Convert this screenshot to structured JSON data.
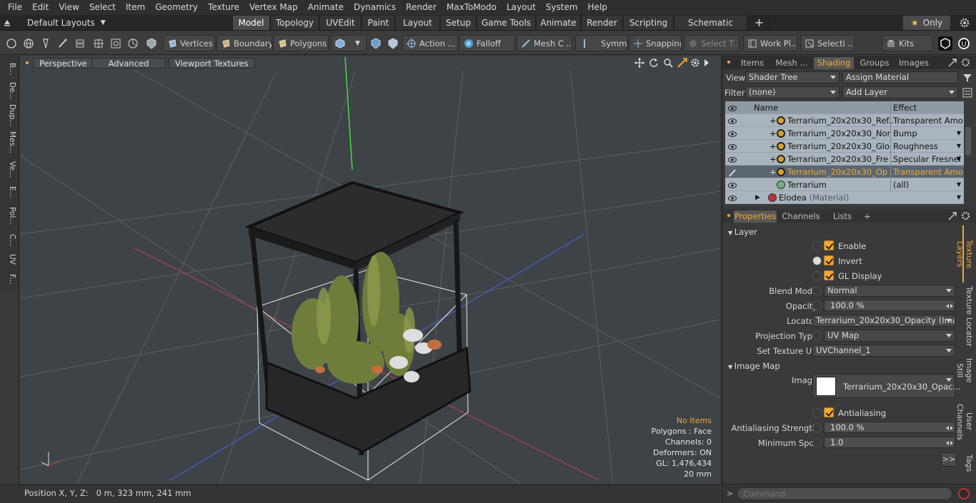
{
  "menu": [
    "File",
    "Edit",
    "View",
    "Select",
    "Item",
    "Geometry",
    "Texture",
    "Vertex Map",
    "Animate",
    "Dynamics",
    "Render",
    "MaxToModo",
    "Layout",
    "System",
    "Help"
  ],
  "modebar": {
    "layouts": "Default Layouts",
    "tabs": [
      "Model",
      "Topology",
      "UVEdit",
      "Paint",
      "Layout",
      "Setup",
      "Game Tools",
      "Animate",
      "Render",
      "Scripting",
      "Schematic Fusion"
    ],
    "active_tab": "Model",
    "only": "Only"
  },
  "toolbar": {
    "vertices": "Vertices",
    "boundary": "Boundary",
    "polygons": "Polygons",
    "action": "Action ...",
    "falloff": "Falloff",
    "mesh": "Mesh C ...",
    "symm": "Symm ...",
    "snapping": "Snapping",
    "select_t": "Select T...",
    "workpl": "Work Pl...",
    "selecti": "Selecti ...",
    "kits": "Kits"
  },
  "lefttabs": [
    "B...",
    "De...",
    "Dup...",
    "Mes...",
    "Ve...",
    "E...",
    "Pol...",
    "C...",
    "UV",
    "F..."
  ],
  "viewport": {
    "perspective": "Perspective",
    "advanced": "Advanced",
    "textures": "Viewport Textures"
  },
  "stats": {
    "noitems": "No Items",
    "polygons": "Polygons : Face",
    "channels": "Channels: 0",
    "deformers": "Deformers: ON",
    "gl": "GL: 1,476,434",
    "scale": "20 mm"
  },
  "status": "Position X, Y, Z:   0 m, 323 mm, 241 mm",
  "top_tabs": [
    "Items",
    "Mesh ...",
    "Shading",
    "Groups",
    "Images"
  ],
  "shading": {
    "view_label": "View",
    "view_value": "Shader Tree",
    "assign": "Assign Material",
    "filter_label": "Filter",
    "filter_value": "(none)",
    "add_layer": "Add Layer",
    "col_name": "Name",
    "col_effect": "Effect",
    "rows": [
      {
        "name": "Terrarium_20x20x30_Ref...",
        "effect": "Transparent Amo ..."
      },
      {
        "name": "Terrarium_20x20x30_Nor ...",
        "effect": "Bump"
      },
      {
        "name": "Terrarium_20x20x30_Glo ...",
        "effect": "Roughness"
      },
      {
        "name": "Terrarium_20x20x30_Fre ...",
        "effect": "Specular Fresnel"
      },
      {
        "name": "Terrarium_20x20x30_Op ...",
        "effect": "Transparent Amo ..."
      },
      {
        "name": "Terrarium",
        "effect": "(all)"
      },
      {
        "name": "Elodea",
        "sub": "(Material)",
        "effect": ""
      }
    ]
  },
  "prop_tabs": [
    "Properties",
    "Channels",
    "Lists"
  ],
  "props": {
    "layer": "Layer",
    "enable": "Enable",
    "invert": "Invert",
    "gldisplay": "GL Display",
    "blend_label": "Blend Mode",
    "blend": "Normal",
    "opacity_label": "Opacity",
    "opacity": "100.0 %",
    "locator_label": "Locator",
    "locator": "Terrarium_20x20x30_Opacity (Ima ...",
    "proj_label": "Projection Type",
    "proj": "UV Map",
    "setuv_label": "Set Texture UV",
    "setuv": "UVChannel_1",
    "imagemap": "Image Map",
    "image_label": "Image",
    "image": "Terrarium_20x20x30_Opac...",
    "antialias": "Antialiasing",
    "aastr_label": "Antialiasing Strength",
    "aastr": "100.0 %",
    "minspot_label": "Minimum Spot",
    "minspot": "1.0"
  },
  "right_vtabs": [
    "Texture Layers",
    "Texture Locator",
    "Image Still",
    "User Channels",
    "Tags"
  ],
  "command": "Command",
  "colors": {
    "accent": "#f0a834",
    "viewport": "#3d4347"
  }
}
